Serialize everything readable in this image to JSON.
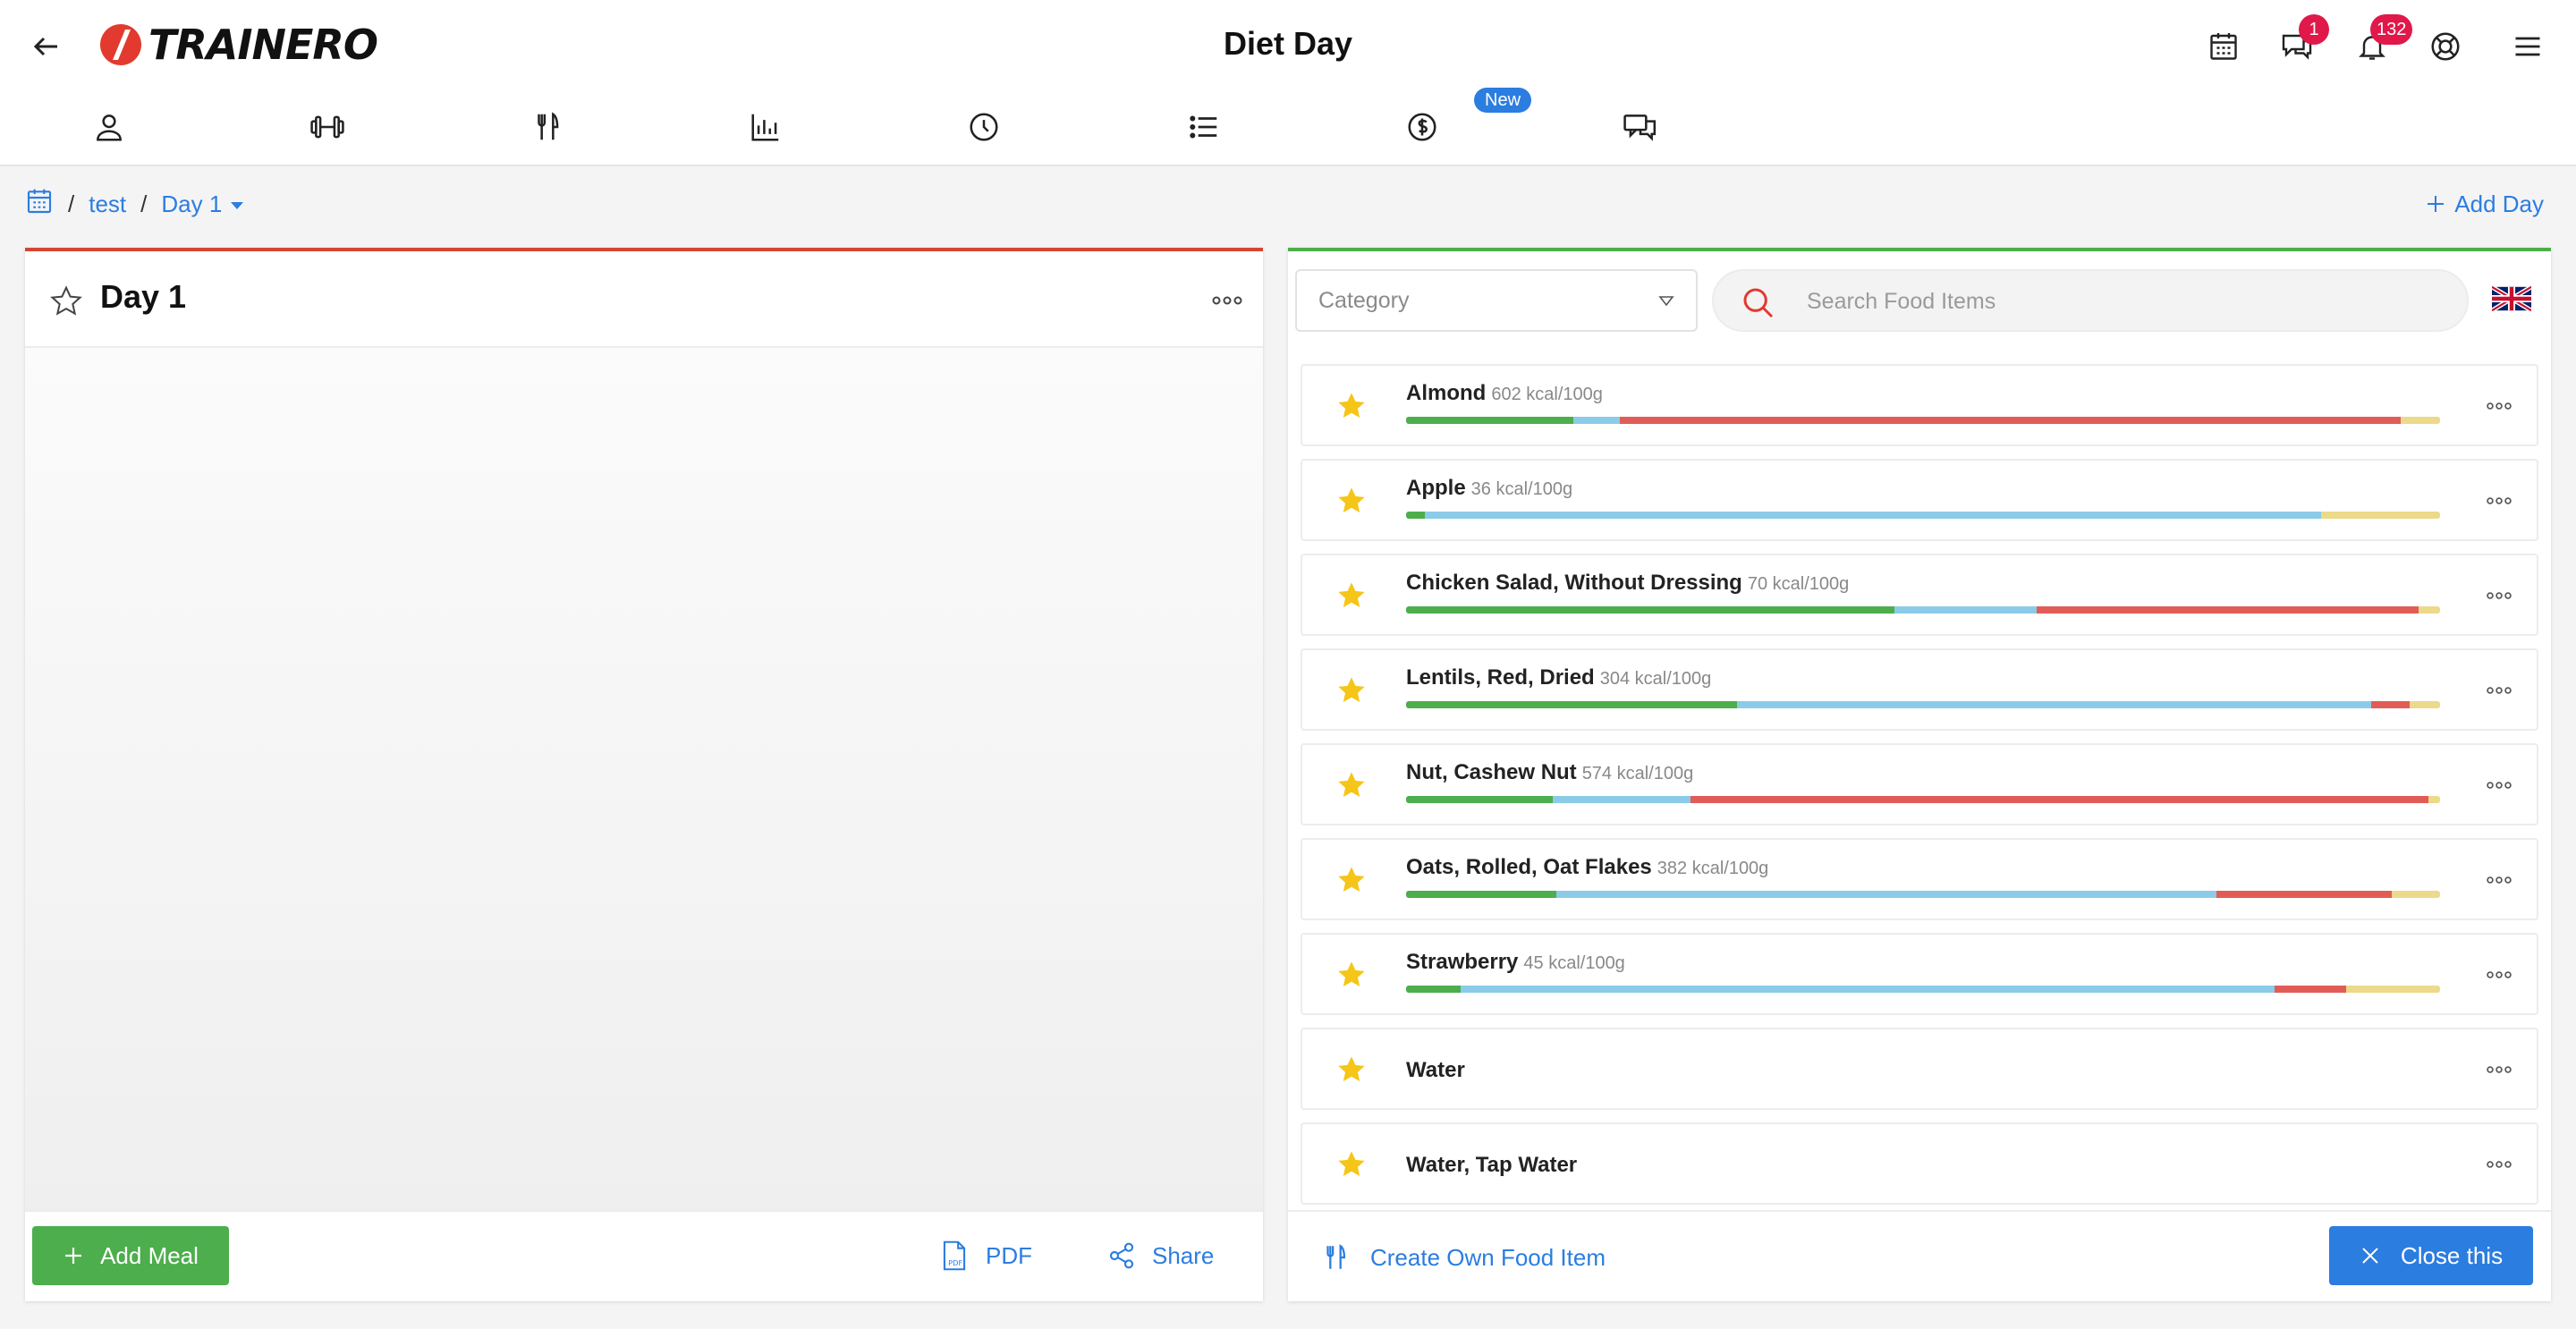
{
  "header": {
    "title": "Diet Day",
    "logo_text": "TRAINERO",
    "messages_badge": "1",
    "notifications_badge": "132"
  },
  "nav": {
    "new_label": "New",
    "icons": [
      "user-icon",
      "dumbbell-icon",
      "fork-knife-icon",
      "bar-chart-icon",
      "clock-icon",
      "list-icon",
      "dollar-icon",
      "chat-icon"
    ]
  },
  "breadcrumb": {
    "root": "test",
    "current": "Day 1",
    "add_day": "Add Day"
  },
  "day_panel": {
    "title": "Day 1",
    "add_meal": "Add Meal",
    "pdf": "PDF",
    "share": "Share"
  },
  "food_panel": {
    "category_placeholder": "Category",
    "search_placeholder": "Search Food Items",
    "create_own": "Create Own Food Item",
    "close": "Close this",
    "colors": {
      "protein": "#4cae4c",
      "carbs": "#8ccbe8",
      "fat": "#e25c57",
      "other": "#ecd98a",
      "star": "#f5c518"
    },
    "items": [
      {
        "name": "Almond",
        "kcal": "602 kcal/100g",
        "macros": [
          0.162,
          0.045,
          0.755,
          0.038
        ]
      },
      {
        "name": "Apple",
        "kcal": "36 kcal/100g",
        "macros": [
          0.018,
          0.867,
          0.0,
          0.115
        ]
      },
      {
        "name": "Chicken Salad, Without Dressing",
        "kcal": "70 kcal/100g",
        "macros": [
          0.472,
          0.138,
          0.369,
          0.021
        ]
      },
      {
        "name": "Lentils, Red, Dried",
        "kcal": "304 kcal/100g",
        "macros": [
          0.32,
          0.613,
          0.038,
          0.029
        ]
      },
      {
        "name": "Nut, Cashew Nut",
        "kcal": "574 kcal/100g",
        "macros": [
          0.142,
          0.133,
          0.714,
          0.011
        ]
      },
      {
        "name": "Oats, Rolled, Oat Flakes",
        "kcal": "382 kcal/100g",
        "macros": [
          0.145,
          0.639,
          0.169,
          0.047
        ]
      },
      {
        "name": "Strawberry",
        "kcal": "45 kcal/100g",
        "macros": [
          0.053,
          0.787,
          0.069,
          0.091
        ]
      },
      {
        "name": "Water",
        "kcal": "",
        "macros": []
      },
      {
        "name": "Water, Tap Water",
        "kcal": "",
        "macros": []
      }
    ]
  }
}
